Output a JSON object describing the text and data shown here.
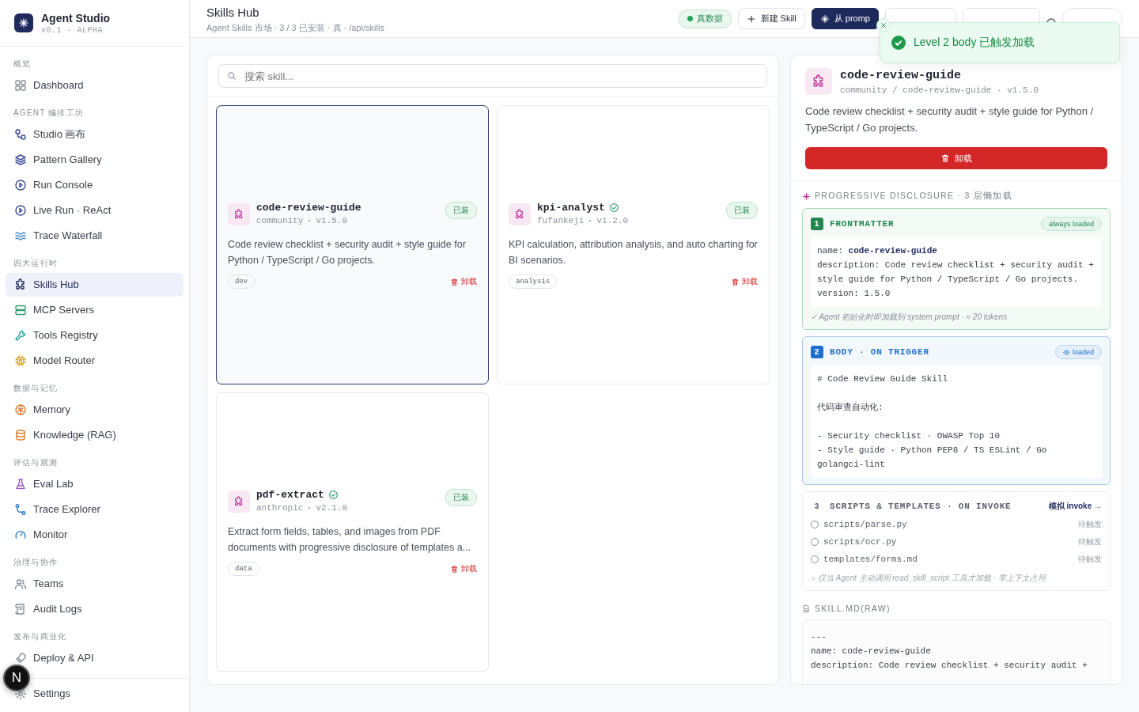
{
  "brand": {
    "name": "Agent Studio",
    "version": "v0.1 · ALPHA"
  },
  "sidebar": {
    "sections": [
      {
        "title": "概览",
        "items": [
          {
            "label": "Dashboard",
            "selected": false
          }
        ]
      },
      {
        "title": "AGENT 编排工坊",
        "items": [
          {
            "label": "Studio 画布",
            "selected": false
          },
          {
            "label": "Pattern Gallery",
            "selected": false
          },
          {
            "label": "Run Console",
            "selected": false
          },
          {
            "label": "Live Run · ReAct",
            "selected": false
          },
          {
            "label": "Trace Waterfall",
            "selected": false
          }
        ]
      },
      {
        "title": "四大运行时",
        "items": [
          {
            "label": "Skills Hub",
            "selected": true
          },
          {
            "label": "MCP Servers",
            "selected": false
          },
          {
            "label": "Tools Registry",
            "selected": false
          },
          {
            "label": "Model Router",
            "selected": false
          }
        ]
      },
      {
        "title": "数据与记忆",
        "items": [
          {
            "label": "Memory",
            "selected": false
          },
          {
            "label": "Knowledge (RAG)",
            "selected": false
          }
        ]
      },
      {
        "title": "评估与观测",
        "items": [
          {
            "label": "Eval Lab",
            "selected": false
          },
          {
            "label": "Trace Explorer",
            "selected": false
          },
          {
            "label": "Monitor",
            "selected": false
          }
        ]
      },
      {
        "title": "治理与协作",
        "items": [
          {
            "label": "Teams",
            "selected": false
          },
          {
            "label": "Audit Logs",
            "selected": false
          }
        ]
      },
      {
        "title": "发布与商业化",
        "items": [
          {
            "label": "Deploy & API",
            "selected": false
          }
        ]
      }
    ],
    "footer": [
      {
        "label": "Settings",
        "selected": false
      }
    ]
  },
  "avatar": "N",
  "header": {
    "title": "Skills Hub",
    "subtitle": "Agent Skills 市场 · 3 / 3 已安装 · 真 · /api/skills",
    "data_badge": "真数据",
    "new_button": "新建 Skill",
    "prompt_button": "从 promp"
  },
  "toast": {
    "message": "Level 2 body 已触发加载"
  },
  "search": {
    "placeholder": "搜索 skill..."
  },
  "skills": [
    {
      "name": "code-review-guide",
      "verified": false,
      "author": "community",
      "version": "v1.5.0",
      "installed": true,
      "status": "已装",
      "description": "Code review checklist + security audit + style guide for Python / TypeScript / Go projects.",
      "tag": "dev",
      "action": "卸载",
      "selected": true
    },
    {
      "name": "kpi-analyst",
      "verified": true,
      "author": "fufankeji",
      "version": "v1.2.0",
      "installed": true,
      "status": "已装",
      "description": "KPI calculation, attribution analysis, and auto charting for BI scenarios.",
      "tag": "analysis",
      "action": "卸载",
      "selected": false
    },
    {
      "name": "pdf-extract",
      "verified": true,
      "author": "anthropic",
      "version": "v2.1.0",
      "installed": true,
      "status": "已装",
      "description": "Extract form fields, tables, and images from PDF documents with progressive disclosure of templates a...",
      "tag": "data",
      "action": "卸载",
      "selected": false
    }
  ],
  "detail": {
    "name": "code-review-guide",
    "path": "community / code-review-guide · v1.5.0",
    "description": "Code review checklist + security audit + style guide for Python / TypeScript / Go projects.",
    "uninstall": "卸载",
    "disclosure_title": "PROGRESSIVE DISCLOSURE · 3 层懒加载",
    "levels": [
      {
        "kind": "frontmatter",
        "number": "1",
        "title": "FRONTMATTER",
        "badge": "always loaded",
        "paragraphs": [
          [
            "name: **code-review-guide**",
            "description: Code review checklist + security audit + style guide for Python / TypeScript / Go projects.",
            "version: 1.5.0"
          ]
        ],
        "note": "✓ Agent 初始化时即加载到 system prompt · ≈ 20 tokens"
      },
      {
        "kind": "body",
        "number": "2",
        "title": "BODY · ON TRIGGER",
        "badge": "loaded",
        "paragraphs": [
          [
            "# Code Review Guide Skill"
          ],
          [
            "代码审查自动化:"
          ],
          [
            "- Security checklist · OWASP Top 10",
            "- Style guide · Python PEP8 / TS ESLint / Go golangci-lint"
          ]
        ]
      },
      {
        "kind": "scripts",
        "number": "3",
        "title": "SCRIPTS & TEMPLATES · ON INVOKE",
        "action": "模拟 invoke →",
        "files": [
          {
            "path": "scripts/parse.py",
            "status": "待触发"
          },
          {
            "path": "scripts/ocr.py",
            "status": "待触发"
          },
          {
            "path": "templates/forms.md",
            "status": "待触发"
          }
        ],
        "note": "○ 仅当 Agent 主动调用 read_skill_script 工具才加载 · 零上下文占用"
      }
    ],
    "raw_title": "SKILL.MD(RAW)",
    "raw_lines": [
      "---",
      "name: code-review-guide",
      "description: Code review checklist + security audit +"
    ]
  }
}
